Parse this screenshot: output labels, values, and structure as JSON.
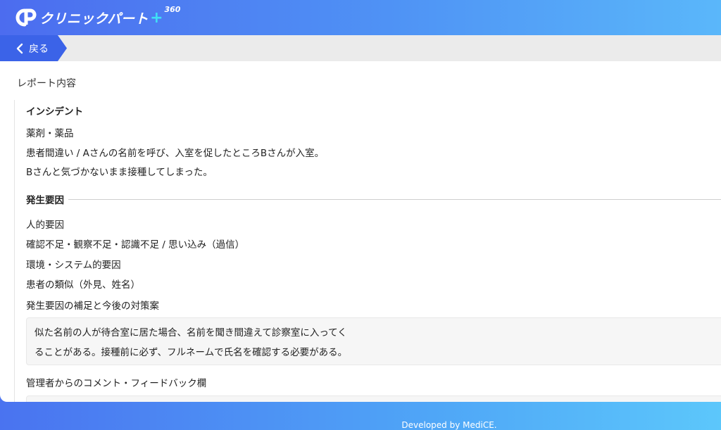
{
  "header": {
    "brand": "クリニックパート",
    "brand_plus": "+",
    "brand_suffix": "360"
  },
  "nav": {
    "back_label": "戻る"
  },
  "page": {
    "section_title": "レポート内容"
  },
  "incident": {
    "heading": "インシデント",
    "category": "薬剤・薬品",
    "line1": "患者間違い / Aさんの名前を呼び、入室を促したところBさんが入室。",
    "line2": "Bさんと気づかないまま接種してしまった。"
  },
  "causes": {
    "heading": "発生要因",
    "human_label": "人的要因",
    "human_value": "確認不足・観察不足・認識不足 / 思い込み（過信）",
    "env_label": "環境・システム的要因",
    "env_value": "患者の類似（外見、姓名）",
    "supplement_label": "発生要因の補足と今後の対策案",
    "supplement_line1": "似た名前の人が待合室に居た場合、名前を聞き間違えて診察室に入ってく",
    "supplement_line2": "ることがある。接種前に必ず、フルネームで氏名を確認する必要がある。"
  },
  "feedback": {
    "label": "管理者からのコメント・フィードバック欄",
    "value": ""
  },
  "footer": {
    "credit": "Developed by MediCE."
  }
}
